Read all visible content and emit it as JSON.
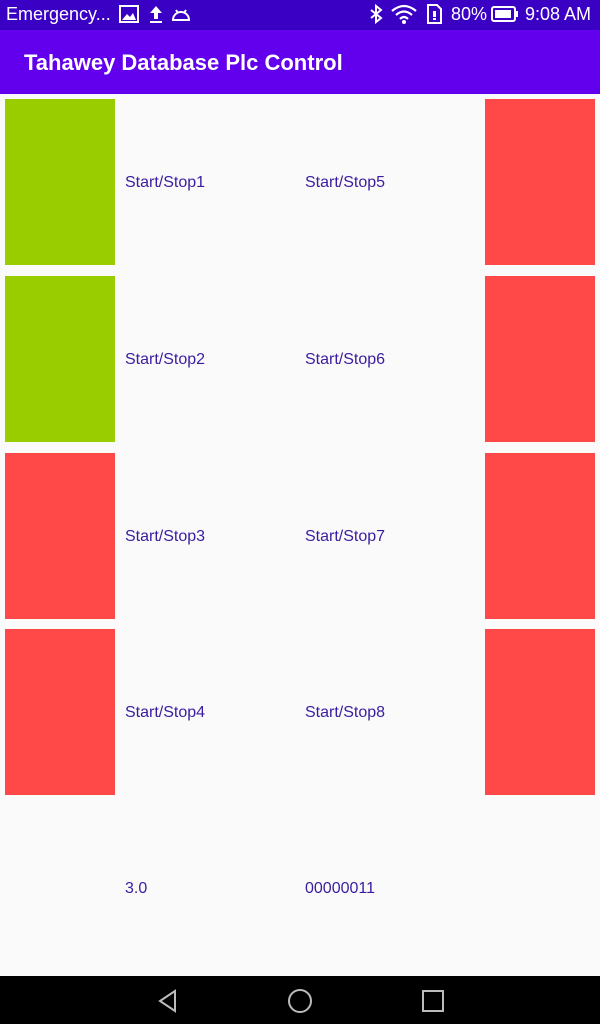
{
  "status_bar": {
    "carrier": "Emergency...",
    "battery": "80%",
    "time": "9:08 AM",
    "icons": [
      "image-icon",
      "upload-icon",
      "android-icon",
      "bluetooth-icon",
      "wifi-icon",
      "sim-icon",
      "battery-icon"
    ]
  },
  "app_bar": {
    "title": "Tahawey Database Plc Control"
  },
  "colors": {
    "status_bar": "#3a00c4",
    "app_bar": "#6200ee",
    "on": "#9acd00",
    "off": "#ff4848",
    "label_text": "#3b1ca0"
  },
  "motors": [
    {
      "label": "Start/Stop1",
      "state": "on"
    },
    {
      "label": "Start/Stop2",
      "state": "on"
    },
    {
      "label": "Start/Stop3",
      "state": "off"
    },
    {
      "label": "Start/Stop4",
      "state": "off"
    },
    {
      "label": "Start/Stop5",
      "state": "off"
    },
    {
      "label": "Start/Stop6",
      "state": "off"
    },
    {
      "label": "Start/Stop7",
      "state": "off"
    },
    {
      "label": "Start/Stop8",
      "state": "off"
    }
  ],
  "readouts": {
    "value": "3.0",
    "bits": "00000011"
  },
  "nav_bar": {
    "icons": [
      "back-icon",
      "home-icon",
      "recents-icon"
    ]
  }
}
